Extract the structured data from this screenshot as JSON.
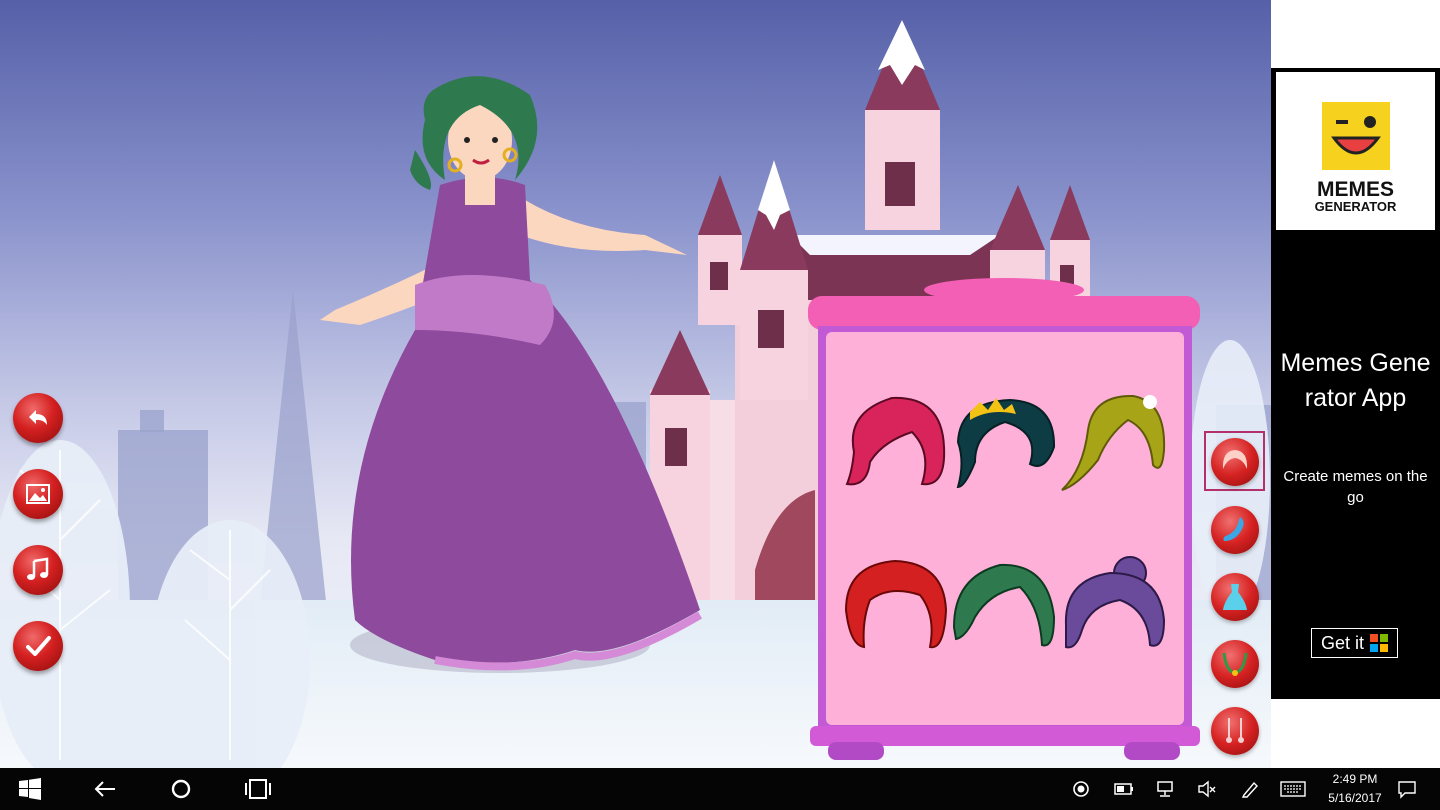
{
  "game": {
    "side_buttons": [
      {
        "name": "back-button",
        "icon": "back-arrow-icon"
      },
      {
        "name": "background-button",
        "icon": "picture-icon"
      },
      {
        "name": "music-button",
        "icon": "music-note-icon"
      },
      {
        "name": "done-button",
        "icon": "checkmark-icon"
      }
    ],
    "wardrobe": {
      "items": [
        {
          "name": "hair-pink-bob",
          "color": "#d8245a"
        },
        {
          "name": "hair-dark-teal-tiara",
          "color": "#0e3c44"
        },
        {
          "name": "hair-olive-blonde",
          "color": "#a8a418"
        },
        {
          "name": "hair-red-curly",
          "color": "#d42020"
        },
        {
          "name": "hair-green-wavy",
          "color": "#2e7a4e"
        },
        {
          "name": "hair-purple-updo",
          "color": "#6a4a9a"
        }
      ]
    },
    "categories": [
      {
        "name": "category-hair",
        "icon": "hair-icon",
        "selected": true
      },
      {
        "name": "category-accessory",
        "icon": "scarf-icon",
        "selected": false
      },
      {
        "name": "category-dress",
        "icon": "dress-icon",
        "selected": false
      },
      {
        "name": "category-necklace",
        "icon": "necklace-icon",
        "selected": false
      },
      {
        "name": "category-earrings",
        "icon": "earrings-icon",
        "selected": false
      }
    ],
    "colors": {
      "wardrobe_pink": "#ffb0d8",
      "wardrobe_frame": "#c25ad6",
      "button_red": "#d42020"
    }
  },
  "ad": {
    "logo_line1": "MEMES",
    "logo_line2": "GENERATOR",
    "title": "Memes Generator App",
    "subtitle": "Create memes on the go",
    "cta": "Get it"
  },
  "taskbar": {
    "time": "2:49 PM",
    "date": "5/16/2017",
    "icons": [
      "windows-start-icon",
      "back-icon",
      "cortana-icon",
      "task-view-icon"
    ],
    "tray_icons": [
      "record-icon",
      "battery-icon",
      "network-icon",
      "volume-muted-icon",
      "pen-icon",
      "keyboard-icon",
      "notification-icon"
    ]
  }
}
